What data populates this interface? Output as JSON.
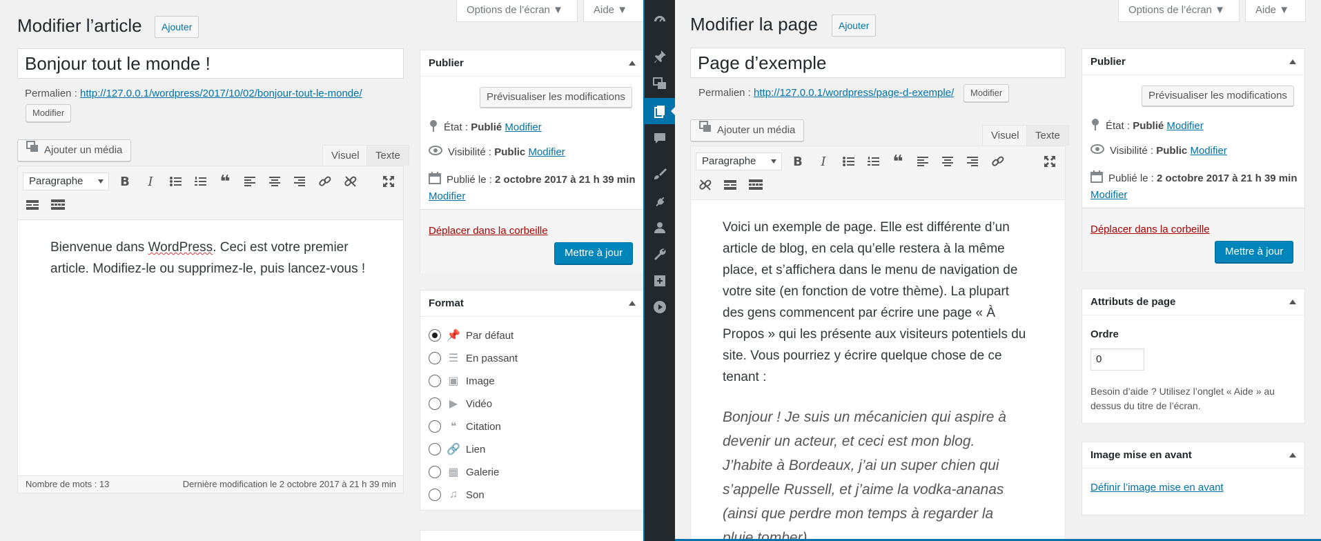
{
  "left": {
    "title": "Modifier l’article",
    "add_new": "Ajouter",
    "screen_options": "Options de l’écran",
    "help": "Aide",
    "post_title": "Bonjour tout le monde !",
    "permalink_label": "Permalien :",
    "permalink_url_base": "http://127.0.0.1/wordpress/2017/10/02/",
    "permalink_slug": "bonjour-tout-le-monde",
    "permalink_end": "/",
    "edit_button": "Modifier",
    "add_media": "Ajouter un média",
    "tab_visual": "Visuel",
    "tab_text": "Texte",
    "format_select": "Paragraphe",
    "content_line1_a": "Bienvenue dans ",
    "content_line1_b": "WordPress",
    "content_line1_c": ". Ceci est votre premier",
    "content_line2": "article. Modifiez-le ou supprimez-le, puis lancez-vous !",
    "word_count": "Nombre de mots : 13",
    "last_modified": "Dernière modification le 2 octobre 2017 à 21 h 39 min",
    "publish": {
      "title": "Publier",
      "preview": "Prévisualiser les modifications",
      "status_label": "État :",
      "status_value": "Publié",
      "visibility_label": "Visibilité :",
      "visibility_value": "Public",
      "published_label": "Publié le :",
      "published_value": "2 octobre 2017 à 21 h 39 min",
      "edit_link": "Modifier",
      "trash": "Déplacer dans la corbeille",
      "update": "Mettre à jour"
    },
    "format_box": {
      "title": "Format",
      "options": [
        "Par défaut",
        "En passant",
        "Image",
        "Vidéo",
        "Citation",
        "Lien",
        "Galerie",
        "Son"
      ],
      "selected": "Par défaut"
    }
  },
  "right": {
    "title": "Modifier la page",
    "add_new": "Ajouter",
    "screen_options": "Options de l’écran",
    "help": "Aide",
    "page_title": "Page d’exemple",
    "permalink_label": "Permalien :",
    "permalink_url_base": "http://127.0.0.1/wordpress/",
    "permalink_slug": "page-d-exemple",
    "permalink_end": "/",
    "edit_button": "Modifier",
    "add_media": "Ajouter un média",
    "tab_visual": "Visuel",
    "tab_text": "Texte",
    "format_select": "Paragraphe",
    "content_lines": [
      "Voici un exemple de page. Elle est différente d’un",
      "article de blog, en cela qu’elle restera à la même",
      "place, et s’affichera dans le menu de navigation de",
      "votre site (en fonction de votre thème). La plupart",
      "des gens commencent par écrire une page « À",
      "Propos » qui les présente aux visiteurs potentiels du",
      "site. Vous pourriez y écrire quelque chose de ce",
      "tenant :"
    ],
    "quote_lines": [
      "Bonjour ! Je suis un mécanicien qui aspire à",
      "devenir un acteur, et ceci est mon blog.",
      "J’habite à Bordeaux, j’ai un super chien qui",
      "s’appelle Russell, et j’aime la vodka-ananas",
      "(ainsi que perdre mon temps à regarder la",
      "pluie tomber)."
    ],
    "publish": {
      "title": "Publier",
      "preview": "Prévisualiser les modifications",
      "status_label": "État :",
      "status_value": "Publié",
      "visibility_label": "Visibilité :",
      "visibility_value": "Public",
      "published_label": "Publié le :",
      "published_value": "2 octobre 2017 à 21 h 39 min",
      "edit_link": "Modifier",
      "trash": "Déplacer dans la corbeille",
      "update": "Mettre à jour"
    },
    "page_attributes": {
      "title": "Attributs de page",
      "order_label": "Ordre",
      "order_value": "0",
      "help_line1": "Besoin d’aide ? Utilisez l’onglet « Aide » au",
      "help_line2": "dessus du titre de l’écran."
    },
    "featured_image": {
      "title": "Image mise en avant",
      "link": "Définir l’image mise en avant"
    }
  },
  "sidebar_icons": [
    "dashboard-icon",
    "posts-pin-icon",
    "media-icon",
    "pages-icon",
    "comments-icon",
    "appearance-brush-icon",
    "plugins-icon",
    "users-icon",
    "tools-wrench-icon",
    "settings-icon",
    "video-play-icon"
  ],
  "colors": {
    "accent": "#0073aa",
    "primary_button": "#0085ba",
    "sidebar": "#23282d",
    "trash": "#a00000"
  }
}
